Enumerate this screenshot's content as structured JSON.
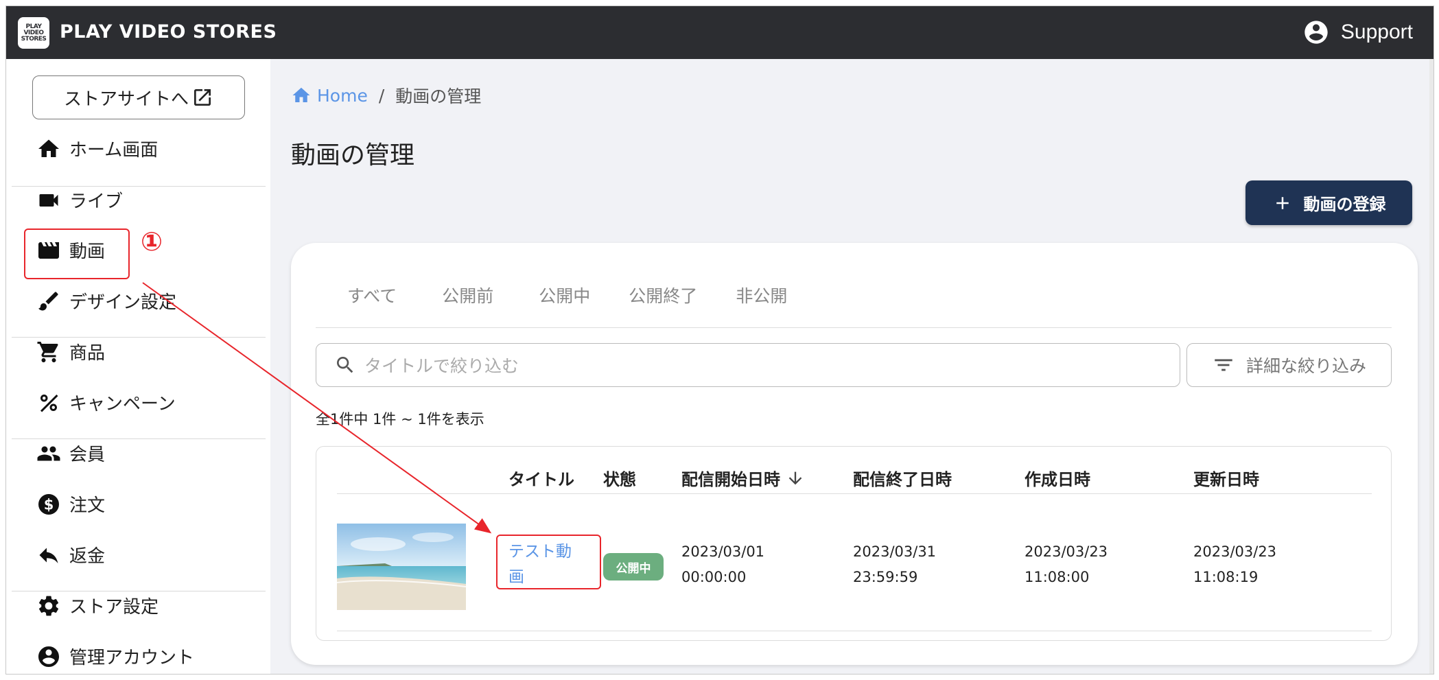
{
  "header": {
    "logo_lines": [
      "PLAY",
      "VIDEO",
      "STORES"
    ],
    "brand": "PLAY VIDEO STORES",
    "support_label": "Support"
  },
  "sidebar": {
    "store_site_label": "ストアサイトへ",
    "items": [
      {
        "label": "ホーム画面",
        "icon": "home-icon"
      },
      {
        "label": "ライブ",
        "icon": "videocam-icon"
      },
      {
        "label": "動画",
        "icon": "clapperboard-icon"
      },
      {
        "label": "デザイン設定",
        "icon": "brush-icon"
      },
      {
        "label": "商品",
        "icon": "cart-icon"
      },
      {
        "label": "キャンペーン",
        "icon": "percent-icon"
      },
      {
        "label": "会員",
        "icon": "people-icon"
      },
      {
        "label": "注文",
        "icon": "dollar-circle-icon"
      },
      {
        "label": "返金",
        "icon": "reply-icon"
      },
      {
        "label": "ストア設定",
        "icon": "gear-icon"
      },
      {
        "label": "管理アカウント",
        "icon": "account-icon"
      }
    ]
  },
  "annotation": {
    "number": "①",
    "color": "#e8252b"
  },
  "breadcrumb": {
    "home": "Home",
    "separator": "/",
    "current": "動画の管理"
  },
  "page": {
    "title": "動画の管理",
    "add_button": "動画の登録"
  },
  "tabs": [
    "すべて",
    "公開前",
    "公開中",
    "公開終了",
    "非公開"
  ],
  "search": {
    "placeholder": "タイトルで絞り込む",
    "filter_button": "詳細な絞り込み"
  },
  "result_count": "全1件中 1件 ~ 1件を表示",
  "table": {
    "headers": [
      "タイトル",
      "状態",
      "配信開始日時",
      "配信終了日時",
      "作成日時",
      "更新日時"
    ],
    "rows": [
      {
        "title": "テスト動画",
        "status": "公開中",
        "start_date": "2023/03/01",
        "start_time": "00:00:00",
        "end_date": "2023/03/31",
        "end_time": "23:59:59",
        "created_date": "2023/03/23",
        "created_time": "11:08:00",
        "updated_date": "2023/03/23",
        "updated_time": "11:08:19"
      }
    ]
  },
  "colors": {
    "topbar": "#2c2d31",
    "accent": "#1f3354",
    "link": "#5b95e6",
    "status_public": "#6cae7f",
    "annotation": "#e8252b"
  }
}
